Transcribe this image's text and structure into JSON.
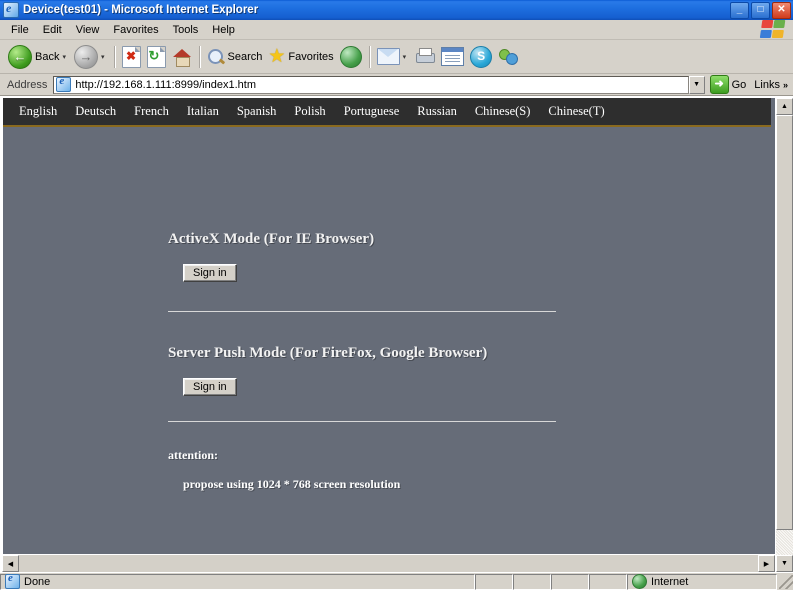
{
  "window": {
    "title": "Device(test01) - Microsoft Internet Explorer",
    "minimize_label": "_",
    "maximize_label": "□",
    "close_label": "✕"
  },
  "menu": {
    "items": [
      {
        "label": "File"
      },
      {
        "label": "Edit"
      },
      {
        "label": "View"
      },
      {
        "label": "Favorites"
      },
      {
        "label": "Tools"
      },
      {
        "label": "Help"
      }
    ]
  },
  "toolbar": {
    "back_label": "Back",
    "search_label": "Search",
    "favorites_label": "Favorites",
    "caret": "▾",
    "back_arrow": "←",
    "forward_arrow": "→",
    "stop_x": "✖",
    "refresh_glyph": "↻",
    "star_glyph": "★"
  },
  "address": {
    "label": "Address",
    "url": "http://192.168.1.111:8999/index1.htm",
    "dropdown_glyph": "▼",
    "go_label": "Go",
    "go_glyph": "➜",
    "links_label": "Links",
    "links_chevron": "»"
  },
  "page": {
    "languages": [
      {
        "label": "English"
      },
      {
        "label": "Deutsch"
      },
      {
        "label": "French"
      },
      {
        "label": "Italian"
      },
      {
        "label": "Spanish"
      },
      {
        "label": "Polish"
      },
      {
        "label": "Portuguese"
      },
      {
        "label": "Russian"
      },
      {
        "label": "Chinese(S)"
      },
      {
        "label": "Chinese(T)"
      }
    ],
    "activex": {
      "heading": "ActiveX Mode (For IE Browser)",
      "signin_label": "Sign in"
    },
    "serverpush": {
      "heading": "Server Push Mode (For FireFox, Google Browser)",
      "signin_label": "Sign in"
    },
    "attention": {
      "title": "attention:",
      "note": "propose using 1024 * 768 screen resolution"
    },
    "colors": {
      "background": "#666c78",
      "navbar": "#2e2e2e",
      "navbar_border": "#8a6a1e",
      "text": "#f2f2f2"
    }
  },
  "scrollbar": {
    "up_glyph": "▲",
    "down_glyph": "▼",
    "left_glyph": "◀",
    "right_glyph": "▶"
  },
  "statusbar": {
    "status": "Done",
    "zone": "Internet"
  }
}
